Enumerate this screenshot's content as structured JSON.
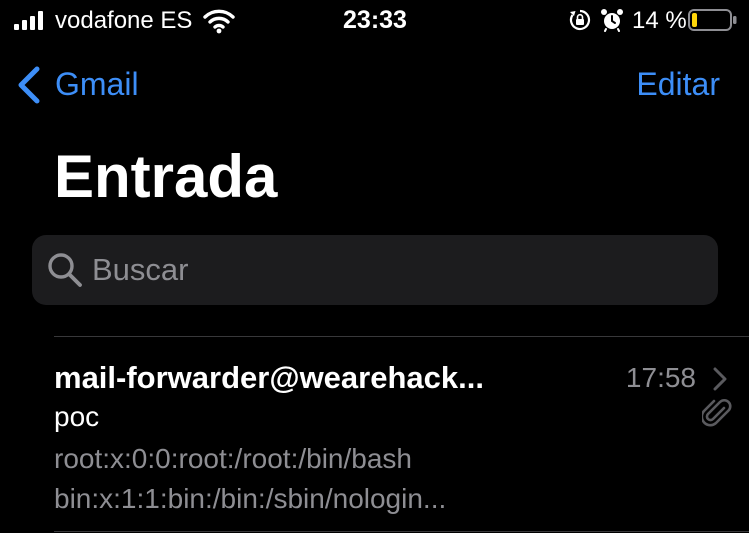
{
  "status_bar": {
    "carrier": "vodafone ES",
    "time": "23:33",
    "battery_percent": "14 %",
    "battery_level": 0.14,
    "battery_color": "#ffd60a",
    "icons": [
      "signal-icon",
      "wifi-icon",
      "orientation-lock-icon",
      "alarm-icon",
      "battery-icon"
    ]
  },
  "nav": {
    "back_label": "Gmail",
    "edit_label": "Editar",
    "title": "Entrada",
    "accent_color": "#3d8ef7"
  },
  "search": {
    "placeholder": "Buscar",
    "value": ""
  },
  "messages": [
    {
      "sender": "mail-forwarder@wearehack...",
      "time": "17:58",
      "subject": "poc",
      "preview_lines": [
        "root:x:0:0:root:/root:/bin/bash",
        "bin:x:1:1:bin:/bin:/sbin/nologin..."
      ],
      "has_attachment": true
    }
  ]
}
